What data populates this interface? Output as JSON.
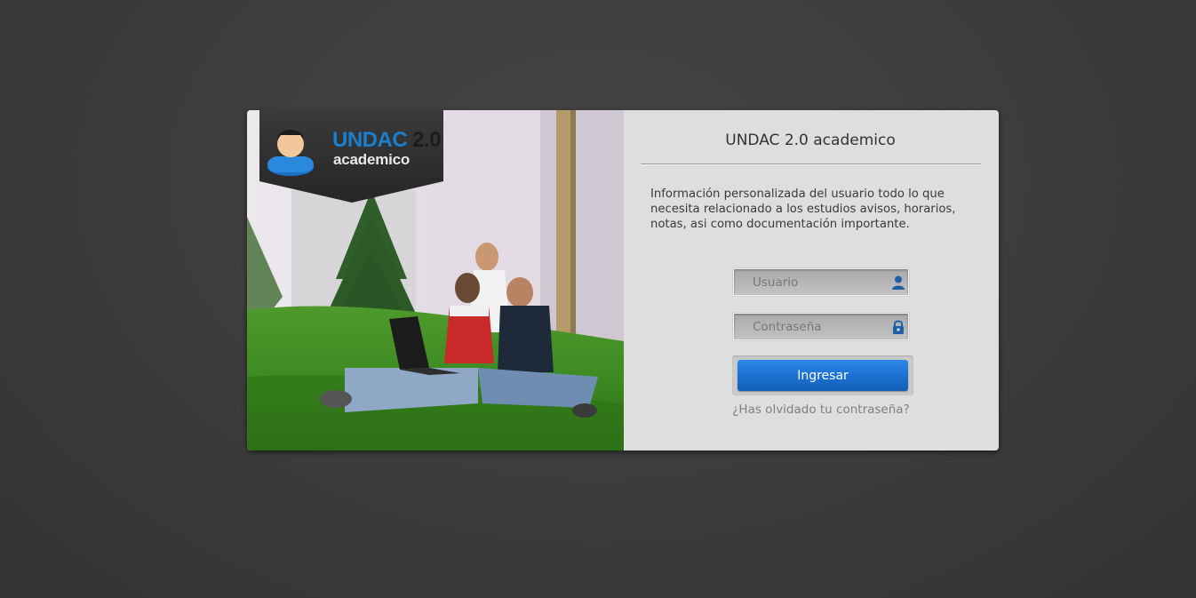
{
  "logo": {
    "brand": "UNDAC",
    "version": "2.0",
    "subtitle": "academico"
  },
  "panel": {
    "title": "UNDAC 2.0 academico",
    "description": "Información  personalizada del usuario todo lo que necesita relacionado a los estudios avisos, horarios, notas, asi como documentación importante."
  },
  "form": {
    "username_placeholder": "Usuario",
    "password_placeholder": "Contraseña",
    "submit_label": "Ingresar",
    "forgot_label": "¿Has olvidado tu contraseña?"
  },
  "icons": {
    "username": "user-icon",
    "password": "lock-icon",
    "logo": "user-avatar-icon"
  },
  "colors": {
    "accent": "#1a6fd0",
    "brand_blue": "#1b7fd0",
    "background": "#3d3d3d",
    "panel": "#dedede"
  }
}
